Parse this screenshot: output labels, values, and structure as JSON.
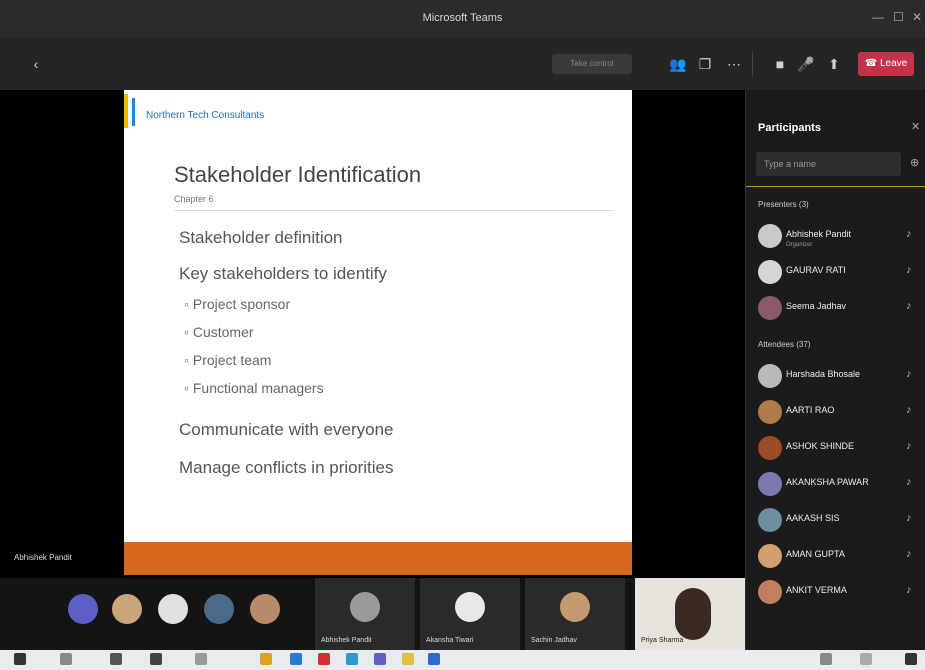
{
  "window": {
    "title": "Microsoft Teams"
  },
  "toolbar": {
    "pill_label": "Take control",
    "leave_label": "Leave"
  },
  "slide": {
    "logo_text": "Northern Tech Consultants",
    "title": "Stakeholder Identification",
    "subtitle": "Chapter 6",
    "bullets": [
      {
        "level": 1,
        "text": "Stakeholder definition"
      },
      {
        "level": 1,
        "text": "Key stakeholders to identify"
      },
      {
        "level": 2,
        "text": "Project sponsor"
      },
      {
        "level": 2,
        "text": "Customer"
      },
      {
        "level": 2,
        "text": "Project team"
      },
      {
        "level": 2,
        "text": "Functional managers"
      },
      {
        "level": 1,
        "text": "Communicate with everyone"
      },
      {
        "level": 1,
        "text": "Manage conflicts in priorities"
      }
    ],
    "presenter_label": "Abhishek Pandit"
  },
  "panel": {
    "title": "Participants",
    "search_placeholder": "Type a name",
    "presenters_label": "Presenters (3)",
    "attendees_label": "Attendees (37)",
    "presenters": [
      {
        "name": "Abhishek Pandit",
        "role": "Organizer",
        "color": "#c9c9c9"
      },
      {
        "name": "GAURAV RATI",
        "role": "",
        "color": "#d6d6d6"
      },
      {
        "name": "Seema Jadhav",
        "role": "",
        "color": "#8a5a66"
      }
    ],
    "attendees": [
      {
        "name": "Harshada Bhosale",
        "color": "#b9b9b9"
      },
      {
        "name": "AARTI RAO",
        "color": "#b07a4a"
      },
      {
        "name": "ASHOK SHINDE",
        "color": "#9c4a2a"
      },
      {
        "name": "AKANKSHA PAWAR",
        "color": "#7a7ab0"
      },
      {
        "name": "AAKASH SIS",
        "color": "#6d8ea0"
      },
      {
        "name": "AMAN GUPTA",
        "color": "#d0a070"
      },
      {
        "name": "ANKIT VERMA",
        "color": "#c08060"
      }
    ]
  },
  "strip": {
    "tiles": [
      {
        "label": "Abhishek Pandit"
      },
      {
        "label": "Akansha Tiwari"
      },
      {
        "label": "Sachin Jadhav"
      },
      {
        "label": "Priya Sharma"
      }
    ]
  }
}
